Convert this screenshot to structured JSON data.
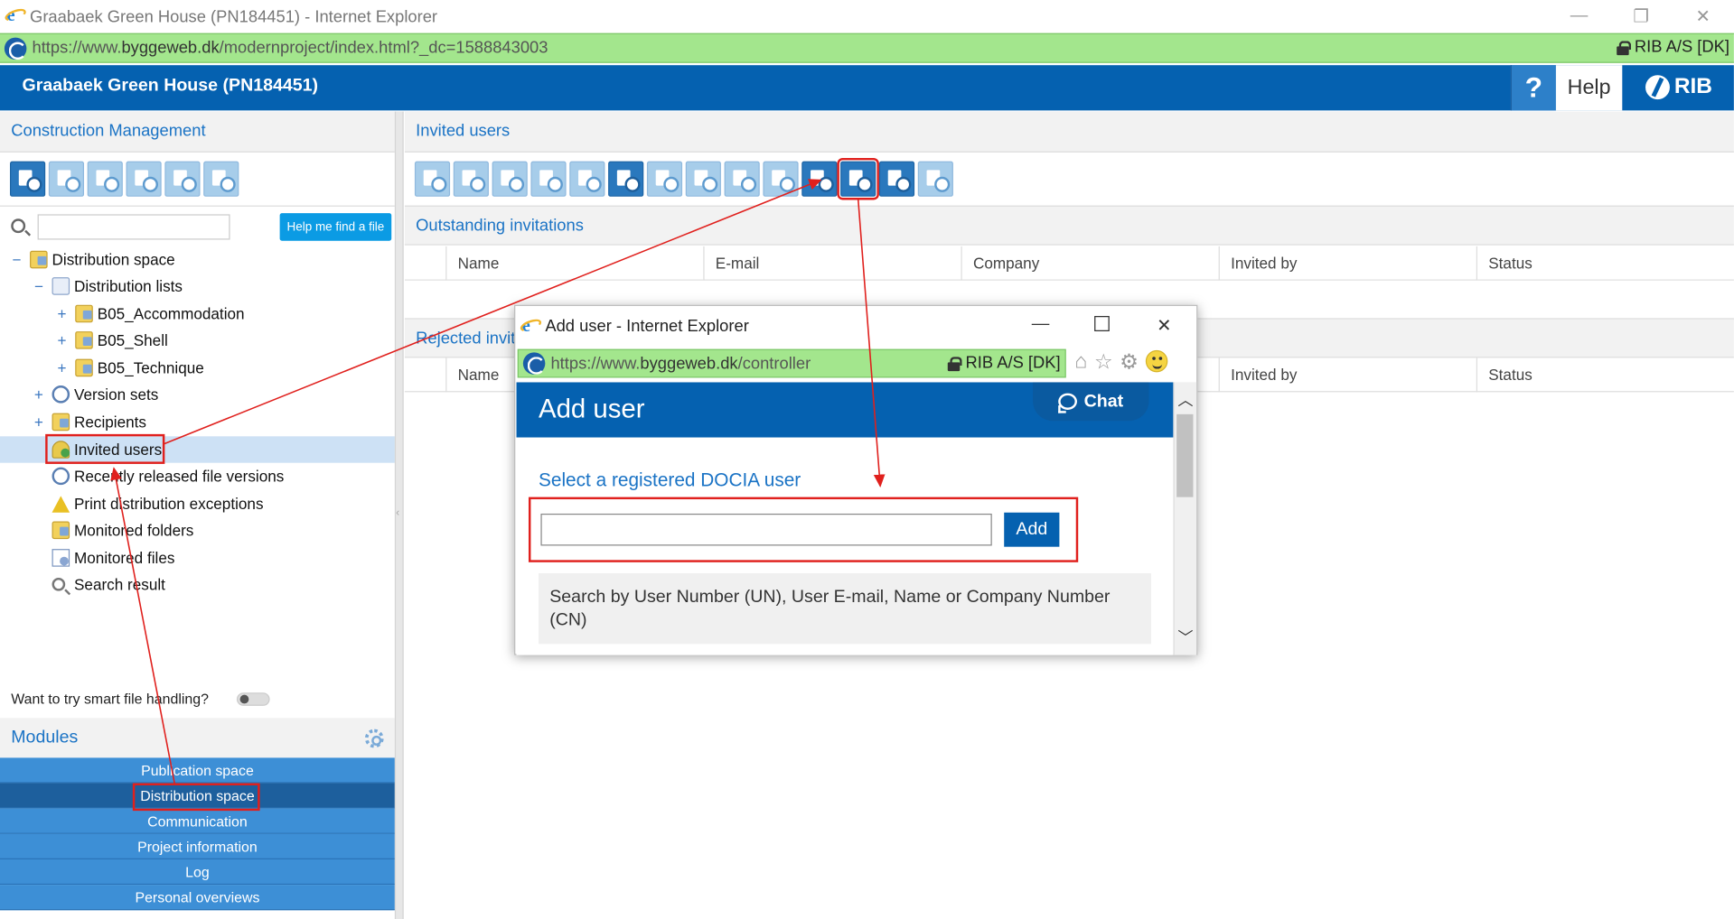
{
  "window": {
    "title": "Graabaek Green House (PN184451) - Internet Explorer",
    "minimize": "—",
    "restore": "❐",
    "close": "✕"
  },
  "address": {
    "url_scheme": "https://www.",
    "url_host": "byggeweb.dk",
    "url_path": "/modernproject/index.html?_dc=1588843003",
    "cert": "RIB A/S [DK]"
  },
  "header": {
    "title": "Graabaek Green House (PN184451)",
    "help_icon": "?",
    "help_label": "Help",
    "logo_text": "RIB"
  },
  "left": {
    "title": "Construction Management",
    "search_value": "",
    "find_button": "Help me find a file",
    "tree": [
      {
        "label": "Distribution space",
        "twisty": "−"
      },
      {
        "label": "Distribution lists",
        "twisty": "−"
      },
      {
        "label": "B05_Accommodation",
        "twisty": "+"
      },
      {
        "label": "B05_Shell",
        "twisty": "+"
      },
      {
        "label": "B05_Technique",
        "twisty": "+"
      },
      {
        "label": "Version sets",
        "twisty": "+"
      },
      {
        "label": "Recipients",
        "twisty": "+"
      },
      {
        "label": "Invited users",
        "twisty": ""
      },
      {
        "label": "Recently released file versions",
        "twisty": ""
      },
      {
        "label": "Print distribution exceptions",
        "twisty": ""
      },
      {
        "label": "Monitored folders",
        "twisty": ""
      },
      {
        "label": "Monitored files",
        "twisty": ""
      },
      {
        "label": "Search result",
        "twisty": ""
      }
    ],
    "smart_prompt": "Want to try smart file handling?",
    "modules_title": "Modules",
    "modules": [
      "Publication space",
      "Distribution space",
      "Communication",
      "Project information",
      "Log",
      "Personal overviews"
    ]
  },
  "right": {
    "title": "Invited users",
    "outstanding_title": "Outstanding invitations",
    "rejected_title": "Rejected invitations",
    "columns": [
      "Name",
      "E-mail",
      "Company",
      "Invited by",
      "Status"
    ]
  },
  "popup": {
    "title": "Add user - Internet Explorer",
    "minimize": "—",
    "maximize": "☐",
    "close": "✕",
    "url_scheme": "https://www.",
    "url_host": "byggeweb.dk",
    "url_path": "/controller",
    "cert": "RIB A/S [DK]",
    "nav_home": "⌂",
    "nav_star": "☆",
    "nav_gear": "⚙",
    "heading": "Add user",
    "chat_label": "Chat",
    "select_label": "Select a registered DOCIA user",
    "input_value": "",
    "add_button": "Add",
    "hint": "Search by User Number (UN), User E-mail, Name or Company Number (CN)",
    "scroll_up": "︿",
    "scroll_down": "﹀"
  },
  "colors": {
    "brand_blue": "#0561b0",
    "address_green": "#a3e68d",
    "annotation_red": "#e0201d"
  }
}
